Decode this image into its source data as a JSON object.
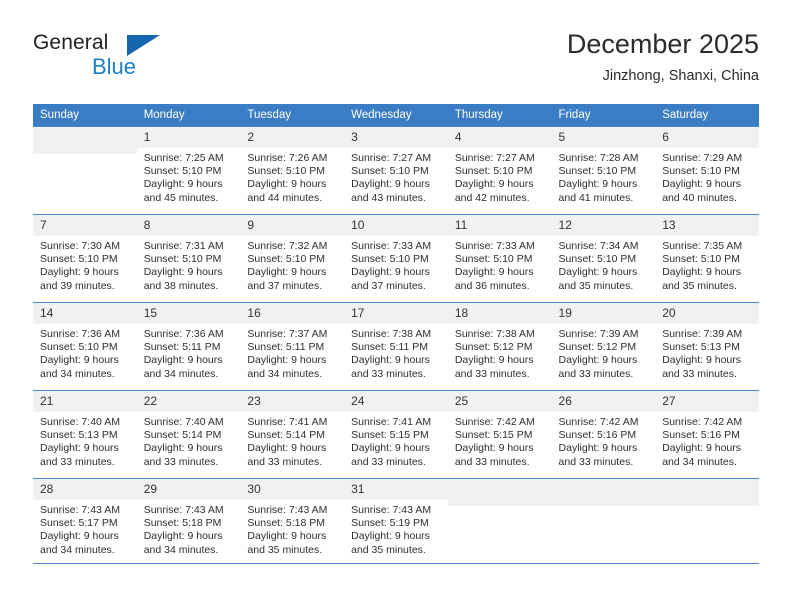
{
  "logo": {
    "word_primary": "General",
    "word_secondary": "Blue",
    "triangle_icon": "triangle-icon",
    "primary_color": "#231f20",
    "secondary_color": "#1f7fc6",
    "triangle_color": "#1565b0"
  },
  "header": {
    "title": "December 2025",
    "subtitle": "Jinzhong, Shanxi, China"
  },
  "theme": {
    "header_row_bg": "#3b7dc4",
    "header_row_text": "#ffffff",
    "daynum_bg": "#f1f1f1",
    "row_divider": "#4a86c8"
  },
  "weekdays": [
    "Sunday",
    "Monday",
    "Tuesday",
    "Wednesday",
    "Thursday",
    "Friday",
    "Saturday"
  ],
  "weeks": [
    [
      {
        "day": "",
        "sunrise": "",
        "sunset": "",
        "daylight_line1": "",
        "daylight_line2": ""
      },
      {
        "day": "1",
        "sunrise": "Sunrise: 7:25 AM",
        "sunset": "Sunset: 5:10 PM",
        "daylight_line1": "Daylight: 9 hours",
        "daylight_line2": "and 45 minutes."
      },
      {
        "day": "2",
        "sunrise": "Sunrise: 7:26 AM",
        "sunset": "Sunset: 5:10 PM",
        "daylight_line1": "Daylight: 9 hours",
        "daylight_line2": "and 44 minutes."
      },
      {
        "day": "3",
        "sunrise": "Sunrise: 7:27 AM",
        "sunset": "Sunset: 5:10 PM",
        "daylight_line1": "Daylight: 9 hours",
        "daylight_line2": "and 43 minutes."
      },
      {
        "day": "4",
        "sunrise": "Sunrise: 7:27 AM",
        "sunset": "Sunset: 5:10 PM",
        "daylight_line1": "Daylight: 9 hours",
        "daylight_line2": "and 42 minutes."
      },
      {
        "day": "5",
        "sunrise": "Sunrise: 7:28 AM",
        "sunset": "Sunset: 5:10 PM",
        "daylight_line1": "Daylight: 9 hours",
        "daylight_line2": "and 41 minutes."
      },
      {
        "day": "6",
        "sunrise": "Sunrise: 7:29 AM",
        "sunset": "Sunset: 5:10 PM",
        "daylight_line1": "Daylight: 9 hours",
        "daylight_line2": "and 40 minutes."
      }
    ],
    [
      {
        "day": "7",
        "sunrise": "Sunrise: 7:30 AM",
        "sunset": "Sunset: 5:10 PM",
        "daylight_line1": "Daylight: 9 hours",
        "daylight_line2": "and 39 minutes."
      },
      {
        "day": "8",
        "sunrise": "Sunrise: 7:31 AM",
        "sunset": "Sunset: 5:10 PM",
        "daylight_line1": "Daylight: 9 hours",
        "daylight_line2": "and 38 minutes."
      },
      {
        "day": "9",
        "sunrise": "Sunrise: 7:32 AM",
        "sunset": "Sunset: 5:10 PM",
        "daylight_line1": "Daylight: 9 hours",
        "daylight_line2": "and 37 minutes."
      },
      {
        "day": "10",
        "sunrise": "Sunrise: 7:33 AM",
        "sunset": "Sunset: 5:10 PM",
        "daylight_line1": "Daylight: 9 hours",
        "daylight_line2": "and 37 minutes."
      },
      {
        "day": "11",
        "sunrise": "Sunrise: 7:33 AM",
        "sunset": "Sunset: 5:10 PM",
        "daylight_line1": "Daylight: 9 hours",
        "daylight_line2": "and 36 minutes."
      },
      {
        "day": "12",
        "sunrise": "Sunrise: 7:34 AM",
        "sunset": "Sunset: 5:10 PM",
        "daylight_line1": "Daylight: 9 hours",
        "daylight_line2": "and 35 minutes."
      },
      {
        "day": "13",
        "sunrise": "Sunrise: 7:35 AM",
        "sunset": "Sunset: 5:10 PM",
        "daylight_line1": "Daylight: 9 hours",
        "daylight_line2": "and 35 minutes."
      }
    ],
    [
      {
        "day": "14",
        "sunrise": "Sunrise: 7:36 AM",
        "sunset": "Sunset: 5:10 PM",
        "daylight_line1": "Daylight: 9 hours",
        "daylight_line2": "and 34 minutes."
      },
      {
        "day": "15",
        "sunrise": "Sunrise: 7:36 AM",
        "sunset": "Sunset: 5:11 PM",
        "daylight_line1": "Daylight: 9 hours",
        "daylight_line2": "and 34 minutes."
      },
      {
        "day": "16",
        "sunrise": "Sunrise: 7:37 AM",
        "sunset": "Sunset: 5:11 PM",
        "daylight_line1": "Daylight: 9 hours",
        "daylight_line2": "and 34 minutes."
      },
      {
        "day": "17",
        "sunrise": "Sunrise: 7:38 AM",
        "sunset": "Sunset: 5:11 PM",
        "daylight_line1": "Daylight: 9 hours",
        "daylight_line2": "and 33 minutes."
      },
      {
        "day": "18",
        "sunrise": "Sunrise: 7:38 AM",
        "sunset": "Sunset: 5:12 PM",
        "daylight_line1": "Daylight: 9 hours",
        "daylight_line2": "and 33 minutes."
      },
      {
        "day": "19",
        "sunrise": "Sunrise: 7:39 AM",
        "sunset": "Sunset: 5:12 PM",
        "daylight_line1": "Daylight: 9 hours",
        "daylight_line2": "and 33 minutes."
      },
      {
        "day": "20",
        "sunrise": "Sunrise: 7:39 AM",
        "sunset": "Sunset: 5:13 PM",
        "daylight_line1": "Daylight: 9 hours",
        "daylight_line2": "and 33 minutes."
      }
    ],
    [
      {
        "day": "21",
        "sunrise": "Sunrise: 7:40 AM",
        "sunset": "Sunset: 5:13 PM",
        "daylight_line1": "Daylight: 9 hours",
        "daylight_line2": "and 33 minutes."
      },
      {
        "day": "22",
        "sunrise": "Sunrise: 7:40 AM",
        "sunset": "Sunset: 5:14 PM",
        "daylight_line1": "Daylight: 9 hours",
        "daylight_line2": "and 33 minutes."
      },
      {
        "day": "23",
        "sunrise": "Sunrise: 7:41 AM",
        "sunset": "Sunset: 5:14 PM",
        "daylight_line1": "Daylight: 9 hours",
        "daylight_line2": "and 33 minutes."
      },
      {
        "day": "24",
        "sunrise": "Sunrise: 7:41 AM",
        "sunset": "Sunset: 5:15 PM",
        "daylight_line1": "Daylight: 9 hours",
        "daylight_line2": "and 33 minutes."
      },
      {
        "day": "25",
        "sunrise": "Sunrise: 7:42 AM",
        "sunset": "Sunset: 5:15 PM",
        "daylight_line1": "Daylight: 9 hours",
        "daylight_line2": "and 33 minutes."
      },
      {
        "day": "26",
        "sunrise": "Sunrise: 7:42 AM",
        "sunset": "Sunset: 5:16 PM",
        "daylight_line1": "Daylight: 9 hours",
        "daylight_line2": "and 33 minutes."
      },
      {
        "day": "27",
        "sunrise": "Sunrise: 7:42 AM",
        "sunset": "Sunset: 5:16 PM",
        "daylight_line1": "Daylight: 9 hours",
        "daylight_line2": "and 34 minutes."
      }
    ],
    [
      {
        "day": "28",
        "sunrise": "Sunrise: 7:43 AM",
        "sunset": "Sunset: 5:17 PM",
        "daylight_line1": "Daylight: 9 hours",
        "daylight_line2": "and 34 minutes."
      },
      {
        "day": "29",
        "sunrise": "Sunrise: 7:43 AM",
        "sunset": "Sunset: 5:18 PM",
        "daylight_line1": "Daylight: 9 hours",
        "daylight_line2": "and 34 minutes."
      },
      {
        "day": "30",
        "sunrise": "Sunrise: 7:43 AM",
        "sunset": "Sunset: 5:18 PM",
        "daylight_line1": "Daylight: 9 hours",
        "daylight_line2": "and 35 minutes."
      },
      {
        "day": "31",
        "sunrise": "Sunrise: 7:43 AM",
        "sunset": "Sunset: 5:19 PM",
        "daylight_line1": "Daylight: 9 hours",
        "daylight_line2": "and 35 minutes."
      },
      {
        "day": "",
        "sunrise": "",
        "sunset": "",
        "daylight_line1": "",
        "daylight_line2": ""
      },
      {
        "day": "",
        "sunrise": "",
        "sunset": "",
        "daylight_line1": "",
        "daylight_line2": ""
      },
      {
        "day": "",
        "sunrise": "",
        "sunset": "",
        "daylight_line1": "",
        "daylight_line2": ""
      }
    ]
  ]
}
